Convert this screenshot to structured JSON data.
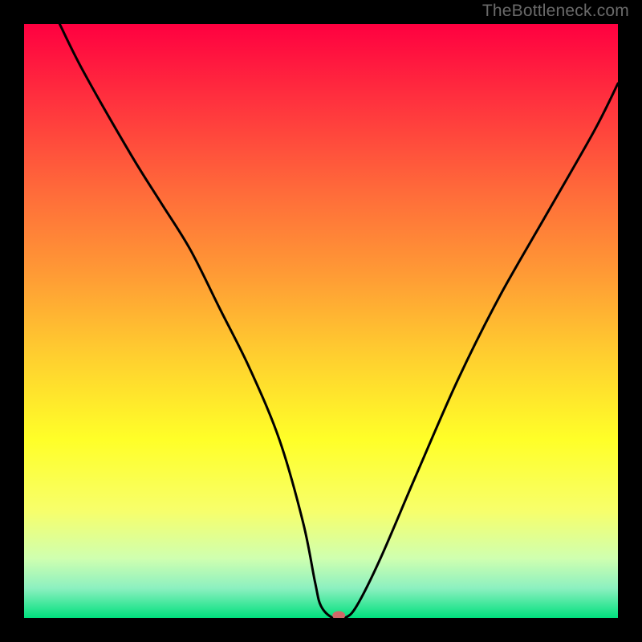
{
  "watermark": "TheBottleneck.com",
  "chart_data": {
    "type": "line",
    "title": "",
    "xlabel": "",
    "ylabel": "",
    "xlim": [
      0,
      100
    ],
    "ylim": [
      0,
      100
    ],
    "grid": false,
    "legend": false,
    "background": {
      "gradient_stops": [
        {
          "pos": 0.0,
          "color": "#ff0040"
        },
        {
          "pos": 0.12,
          "color": "#ff2e3e"
        },
        {
          "pos": 0.28,
          "color": "#ff6a3a"
        },
        {
          "pos": 0.42,
          "color": "#ff9a35"
        },
        {
          "pos": 0.56,
          "color": "#ffcf2f"
        },
        {
          "pos": 0.7,
          "color": "#ffff28"
        },
        {
          "pos": 0.82,
          "color": "#f7ff6b"
        },
        {
          "pos": 0.9,
          "color": "#cfffb0"
        },
        {
          "pos": 0.95,
          "color": "#8cf0c0"
        },
        {
          "pos": 1.0,
          "color": "#00e07d"
        }
      ]
    },
    "series": [
      {
        "name": "bottleneck-curve",
        "color": "#000000",
        "x": [
          6,
          10,
          18,
          23,
          28,
          33,
          38,
          43,
          47,
          49,
          50,
          52,
          54,
          56,
          60,
          66,
          73,
          80,
          88,
          96,
          100
        ],
        "values": [
          100,
          92,
          78,
          70,
          62,
          52,
          42,
          30,
          16,
          6,
          2,
          0,
          0,
          2,
          10,
          24,
          40,
          54,
          68,
          82,
          90
        ]
      }
    ],
    "marker": {
      "name": "optimum-point",
      "x": 53,
      "y": 0,
      "color": "#d06868"
    }
  }
}
